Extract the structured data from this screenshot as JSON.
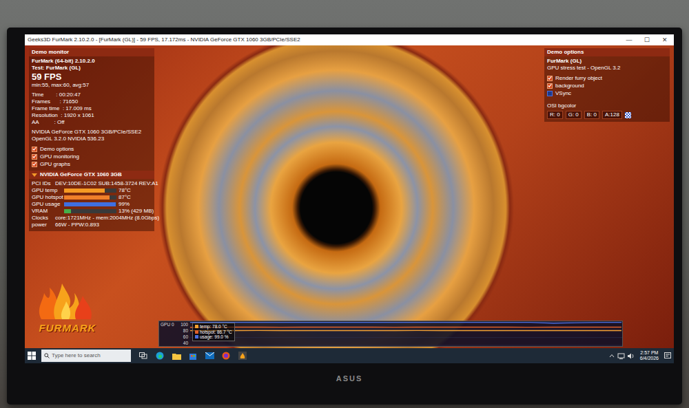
{
  "window": {
    "title": "Geeks3D FurMark 2.10.2.0 - [FurMark (GL)] - 59 FPS, 17.172ms - NVIDIA GeForce GTX 1060 3GB/PCIe/SSE2",
    "controls": [
      "—",
      "☐",
      "✕"
    ]
  },
  "demo_monitor": {
    "header": "Demo monitor",
    "app": "FurMark (64-bit) 2.10.2.0",
    "test": "Test: FurMark (GL)",
    "fps": "59 FPS",
    "fps_stats": "min:55, max:60, avg:57",
    "stats": [
      "Time        : 00:20:47",
      "Frames      : 71650",
      "Frame time  : 17.009 ms",
      "Resolution  : 1920 x 1061",
      "AA          : Off"
    ],
    "renderer": [
      "NVIDIA GeForce GTX 1060 3GB/PCIe/SSE2",
      "OpenGL 3.2.0 NVIDIA 536.23"
    ],
    "options": [
      {
        "label": "Demo options",
        "checked": true
      },
      {
        "label": "GPU monitoring",
        "checked": true
      },
      {
        "label": "GPU graphs",
        "checked": true
      }
    ]
  },
  "gpu": {
    "header": "NVIDIA GeForce GTX 1060 3GB",
    "pci_label": "PCI IDs",
    "pci": "DEV:10DE-1C02 SUB:1458-3724 REV:A1",
    "meters": [
      {
        "label": "GPU temp",
        "reading": "78°C",
        "level": 0.78,
        "color": "#f59a23"
      },
      {
        "label": "GPU hotspot",
        "reading": "87°C",
        "level": 0.87,
        "color": "#ef7f2a"
      },
      {
        "label": "GPU usage",
        "reading": "99%",
        "level": 0.99,
        "color": "#3f6fe0"
      },
      {
        "label": "VRAM",
        "reading": "13% (429 MB)",
        "level": 0.13,
        "color": "#46b04a"
      }
    ],
    "info": [
      {
        "label": "Clocks",
        "value": "core:1721MHz - mem:2004MHz (8.0Gbps)"
      },
      {
        "label": "power",
        "value": "66W - PPW:0.893"
      }
    ]
  },
  "demo_options": {
    "header": "Demo options",
    "title": "FurMark (GL)",
    "subtitle": "GPU stress test - OpenGL 3.2",
    "options": [
      {
        "label": "Render furry object",
        "checked": true
      },
      {
        "label": "background",
        "checked": true
      },
      {
        "label": "VSync",
        "checked": false
      }
    ],
    "bgcolor_label": "OSI bgcolor",
    "bgcolor": [
      "R: 0",
      "G: 0",
      "B: 0",
      "A:128"
    ]
  },
  "logo": {
    "text": "FURMARK"
  },
  "graph": {
    "label": "GPU 0",
    "ticks": [
      "100",
      "80",
      "60",
      "40"
    ],
    "series": [
      {
        "name": "temp: 78.0 °C",
        "color": "#f5a030",
        "values": [
          77.8,
          78,
          78,
          78.1,
          78,
          78,
          77.9,
          78,
          78,
          78,
          78.1,
          78,
          78,
          78,
          78,
          77.9,
          78,
          78,
          78,
          78
        ]
      },
      {
        "name": "hotspot: 86.7 °C",
        "color": "#e0602a",
        "values": [
          86.5,
          86.6,
          86.7,
          86.7,
          86.6,
          86.7,
          86.8,
          86.7,
          86.7,
          86.6,
          86.7,
          86.7,
          86.8,
          86.7,
          86.7,
          86.6,
          86.7,
          86.7,
          86.7,
          86.7
        ]
      },
      {
        "name": "usage: 99.0 %",
        "color": "#4a6fe0",
        "values": [
          99,
          99,
          99,
          99,
          99,
          99,
          99,
          99,
          99,
          99,
          99,
          99,
          99,
          99,
          99,
          99,
          97,
          98,
          99,
          99
        ]
      }
    ]
  },
  "taskbar": {
    "search": {
      "placeholder": "Type here to search"
    },
    "time": "2:57 PM",
    "date": "6/4/2026"
  },
  "monitor": {
    "brand": "ASUS"
  }
}
